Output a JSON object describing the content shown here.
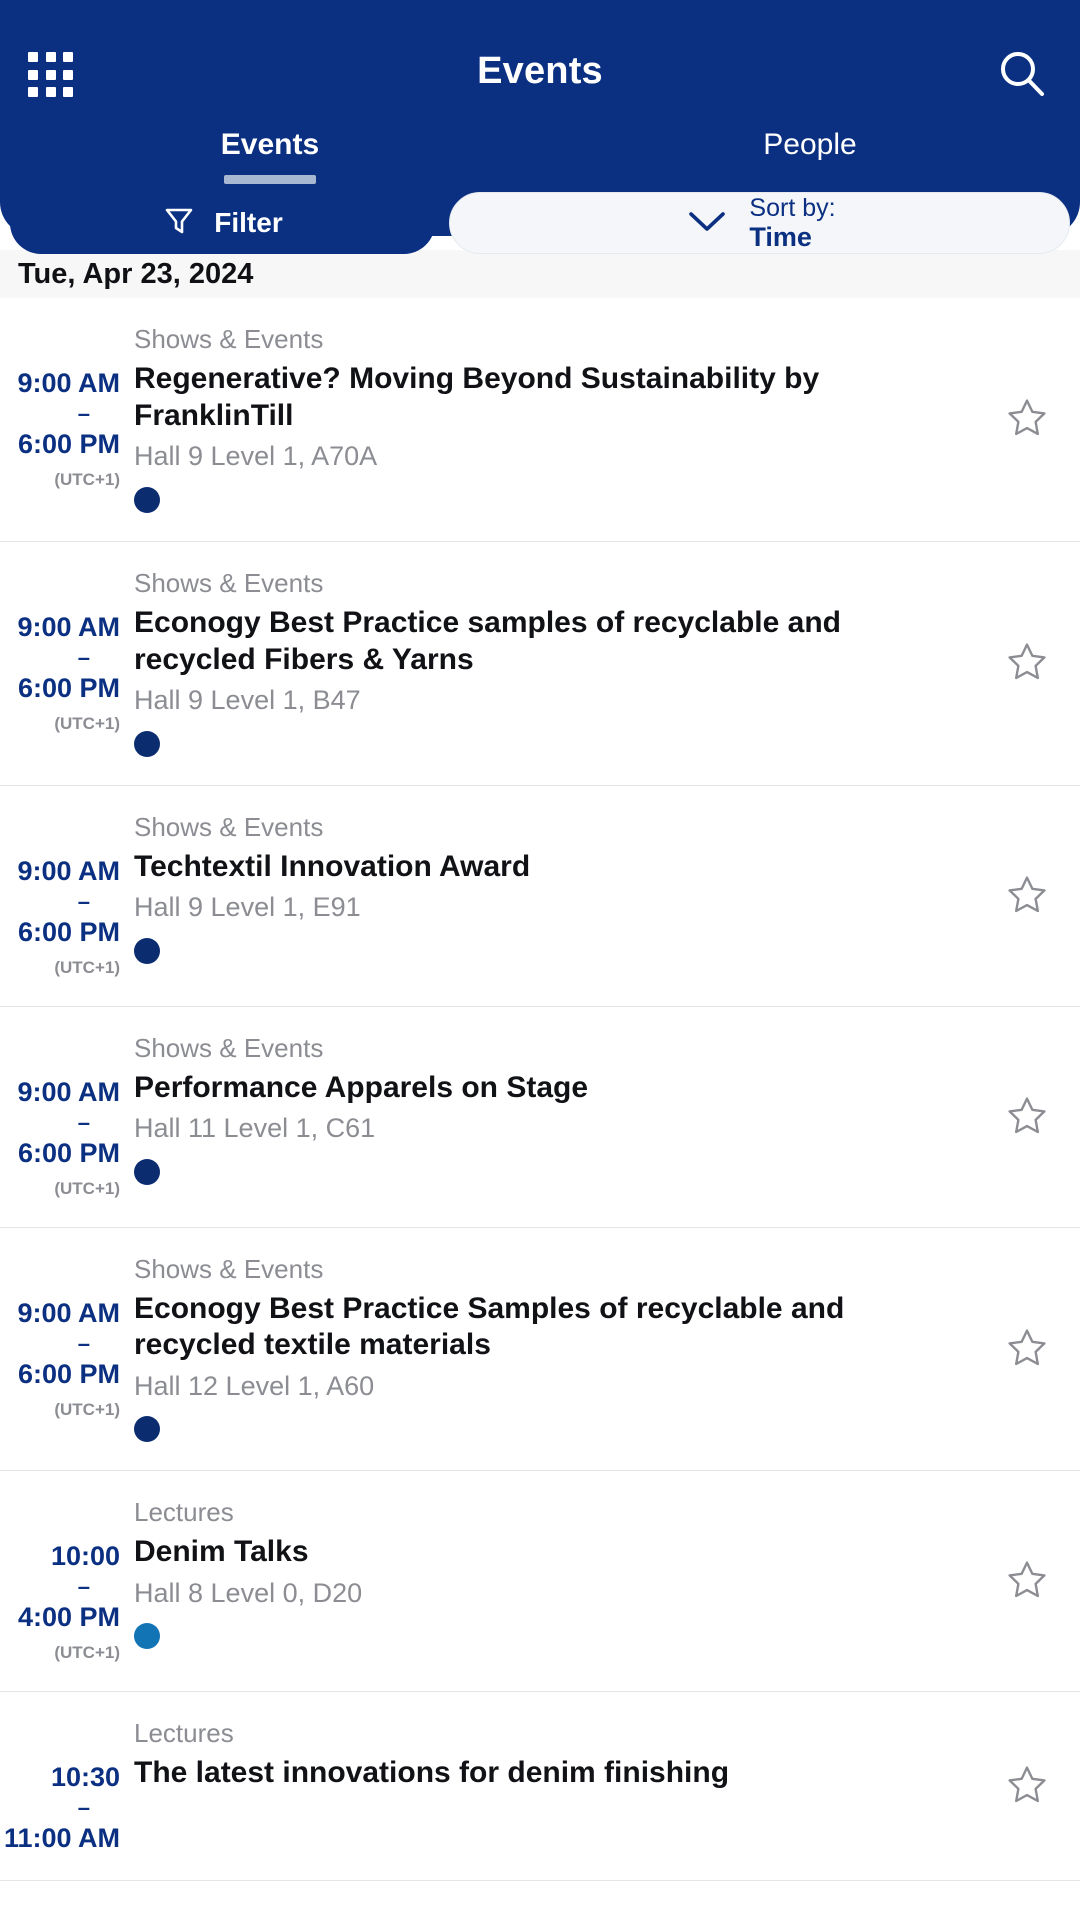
{
  "header": {
    "title": "Events",
    "grid_icon": "grid-menu-icon",
    "search_icon": "search-icon",
    "tabs": [
      {
        "label": "Events",
        "active": true
      },
      {
        "label": "People",
        "active": false
      }
    ]
  },
  "toolbar": {
    "filter_label": "Filter",
    "filter_icon": "funnel-icon",
    "sort_label": "Sort by:",
    "sort_value": "Time",
    "sort_icon": "chevron-down-icon"
  },
  "colors": {
    "brand_navy": "#0B3082",
    "dot_shows": "#0B2D70",
    "dot_lectures": "#1273B5",
    "muted_grey": "#8B8D93",
    "date_bar_bg": "#F7F7F8"
  },
  "date_header": "Tue, Apr 23, 2024",
  "events": [
    {
      "start": "9:00 AM",
      "dash": "–",
      "end": "6:00 PM",
      "utc": "(UTC+1)",
      "category": "Shows & Events",
      "title": "Regenerative? Moving Beyond Sustainability by FranklinTill",
      "location": "Hall 9 Level 1, A70A",
      "dot_color": "#0B2D70",
      "favorite": false
    },
    {
      "start": "9:00 AM",
      "dash": "–",
      "end": "6:00 PM",
      "utc": "(UTC+1)",
      "category": "Shows & Events",
      "title": "Econogy Best Practice samples of recyclable and recycled Fibers & Yarns",
      "location": "Hall 9 Level 1, B47",
      "dot_color": "#0B2D70",
      "favorite": false
    },
    {
      "start": "9:00 AM",
      "dash": "–",
      "end": "6:00 PM",
      "utc": "(UTC+1)",
      "category": "Shows & Events",
      "title": "Techtextil Innovation Award",
      "location": "Hall 9 Level 1, E91",
      "dot_color": "#0B2D70",
      "favorite": false
    },
    {
      "start": "9:00 AM",
      "dash": "–",
      "end": "6:00 PM",
      "utc": "(UTC+1)",
      "category": "Shows & Events",
      "title": "Performance Apparels on Stage",
      "location": "Hall 11 Level 1, C61",
      "dot_color": "#0B2D70",
      "favorite": false
    },
    {
      "start": "9:00 AM",
      "dash": "–",
      "end": "6:00 PM",
      "utc": "(UTC+1)",
      "category": "Shows & Events",
      "title": "Econogy Best Practice Samples of recyclable and recycled textile materials",
      "location": "Hall 12 Level 1, A60",
      "dot_color": "#0B2D70",
      "favorite": false
    },
    {
      "start": "10:00",
      "dash": "–",
      "end": "4:00 PM",
      "utc": "(UTC+1)",
      "category": "Lectures",
      "title": "Denim Talks",
      "location": "Hall 8 Level 0, D20",
      "dot_color": "#1273B5",
      "favorite": false
    },
    {
      "start": "10:30",
      "dash": "–",
      "end": "11:00 AM",
      "utc": "",
      "category": "Lectures",
      "title": "The latest innovations for denim finishing",
      "location": "",
      "dot_color": "",
      "favorite": false
    }
  ]
}
